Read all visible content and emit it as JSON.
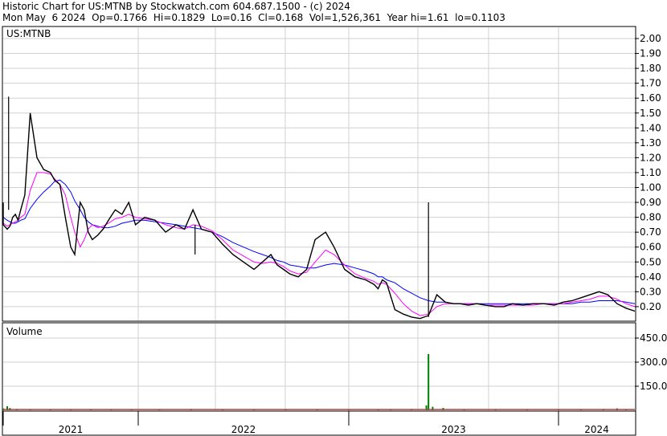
{
  "header": {
    "line1": "Historic Chart for US:MTNB by Stockwatch.com 604.687.1500 - (c) 2024",
    "line2": "Mon May  6 2024  Op=0.1766  Hi=0.1829  Lo=0.16  Cl=0.168  Vol=1,526,361  Year hi=1.61  lo=0.1103"
  },
  "chart_data": [
    {
      "type": "line",
      "title": "US:MTNB",
      "ylim": [
        0.1,
        2.05
      ],
      "y_ticks": [
        "2.00",
        "1.90",
        "1.80",
        "1.70",
        "1.60",
        "1.50",
        "1.40",
        "1.30",
        "1.20",
        "1.10",
        "1.00",
        "0.90",
        "0.80",
        "0.70",
        "0.60",
        "0.50",
        "0.40",
        "0.30",
        "0.20"
      ],
      "x_ticks": [
        "2021",
        "2022",
        "2023",
        "2024"
      ],
      "grid": true,
      "colors": {
        "price": "#000000",
        "ma_short": "#ff00ff",
        "ma_long": "#0000ff"
      },
      "x": [
        2020.73,
        2020.8,
        2020.88,
        2020.95,
        2021.0,
        2021.03,
        2021.05,
        2021.07,
        2021.09,
        2021.11,
        2021.13,
        2021.16,
        2021.2,
        2021.25,
        2021.3,
        2021.35,
        2021.38,
        2021.42,
        2021.46,
        2021.5,
        2021.53,
        2021.57,
        2021.6,
        2021.63,
        2021.66,
        2021.7,
        2021.74,
        2021.78,
        2021.83,
        2021.88,
        2021.93,
        2021.98,
        2022.03,
        2022.08,
        2022.13,
        2022.18,
        2022.22,
        2022.26,
        2022.3,
        2022.35,
        2022.4,
        2022.45,
        2022.5,
        2022.55,
        2022.59,
        2022.63,
        2022.66,
        2022.69,
        2022.72,
        2022.76,
        2022.8,
        2022.84,
        2022.89,
        2022.93,
        2022.98,
        2023.03,
        2023.08,
        2023.12,
        2023.14,
        2023.16,
        2023.18,
        2023.22,
        2023.26,
        2023.3,
        2023.34,
        2023.38,
        2023.42,
        2023.46,
        2023.5,
        2023.53,
        2023.57,
        2023.61,
        2023.65,
        2023.7,
        2023.74,
        2023.78,
        2023.83,
        2023.88,
        2023.93,
        2023.98,
        2024.02,
        2024.06,
        2024.1,
        2024.14,
        2024.18,
        2024.22,
        2024.26,
        2024.3,
        2024.34
      ],
      "price": [
        0.78,
        0.85,
        0.9,
        0.8,
        0.75,
        0.72,
        0.74,
        0.8,
        0.82,
        0.78,
        0.85,
        0.95,
        1.5,
        1.2,
        1.12,
        1.1,
        1.05,
        1.02,
        0.8,
        0.6,
        0.55,
        0.9,
        0.85,
        0.7,
        0.65,
        0.68,
        0.72,
        0.78,
        0.85,
        0.82,
        0.9,
        0.75,
        0.8,
        0.78,
        0.7,
        0.75,
        0.72,
        0.85,
        0.72,
        0.7,
        0.62,
        0.55,
        0.5,
        0.45,
        0.5,
        0.55,
        0.48,
        0.45,
        0.42,
        0.4,
        0.45,
        0.65,
        0.7,
        0.6,
        0.45,
        0.4,
        0.38,
        0.35,
        0.32,
        0.38,
        0.36,
        0.18,
        0.15,
        0.13,
        0.12,
        0.14,
        0.28,
        0.23,
        0.22,
        0.22,
        0.21,
        0.22,
        0.21,
        0.2,
        0.2,
        0.22,
        0.21,
        0.22,
        0.22,
        0.21,
        0.23,
        0.24,
        0.26,
        0.28,
        0.3,
        0.28,
        0.22,
        0.19,
        0.17
      ],
      "ma_short": [
        0.8,
        0.8,
        0.82,
        0.8,
        0.76,
        0.74,
        0.75,
        0.76,
        0.77,
        0.78,
        0.8,
        0.82,
        0.98,
        1.1,
        1.1,
        1.09,
        1.06,
        1.02,
        0.95,
        0.8,
        0.7,
        0.6,
        0.65,
        0.72,
        0.75,
        0.73,
        0.74,
        0.76,
        0.79,
        0.8,
        0.82,
        0.8,
        0.79,
        0.78,
        0.75,
        0.73,
        0.72,
        0.75,
        0.74,
        0.71,
        0.65,
        0.58,
        0.54,
        0.5,
        0.49,
        0.5,
        0.49,
        0.47,
        0.44,
        0.42,
        0.43,
        0.5,
        0.58,
        0.55,
        0.48,
        0.42,
        0.39,
        0.37,
        0.35,
        0.36,
        0.35,
        0.29,
        0.22,
        0.17,
        0.14,
        0.15,
        0.2,
        0.22,
        0.22,
        0.22,
        0.22,
        0.22,
        0.21,
        0.21,
        0.21,
        0.21,
        0.21,
        0.21,
        0.22,
        0.22,
        0.22,
        0.23,
        0.24,
        0.25,
        0.27,
        0.27,
        0.25,
        0.22,
        0.2
      ],
      "ma_long": [
        0.82,
        0.82,
        0.82,
        0.81,
        0.8,
        0.78,
        0.77,
        0.76,
        0.76,
        0.77,
        0.78,
        0.79,
        0.86,
        0.92,
        0.97,
        1.01,
        1.04,
        1.05,
        1.02,
        0.97,
        0.91,
        0.85,
        0.8,
        0.77,
        0.75,
        0.74,
        0.73,
        0.73,
        0.74,
        0.76,
        0.77,
        0.78,
        0.78,
        0.77,
        0.76,
        0.75,
        0.74,
        0.73,
        0.72,
        0.7,
        0.67,
        0.63,
        0.6,
        0.57,
        0.55,
        0.53,
        0.51,
        0.5,
        0.48,
        0.47,
        0.46,
        0.46,
        0.48,
        0.49,
        0.48,
        0.46,
        0.44,
        0.42,
        0.4,
        0.4,
        0.38,
        0.36,
        0.32,
        0.29,
        0.26,
        0.24,
        0.23,
        0.23,
        0.22,
        0.22,
        0.22,
        0.22,
        0.22,
        0.22,
        0.22,
        0.22,
        0.22,
        0.22,
        0.22,
        0.22,
        0.22,
        0.22,
        0.23,
        0.23,
        0.24,
        0.24,
        0.24,
        0.23,
        0.22
      ],
      "spikes": [
        {
          "x": 2023.38,
          "low": 0.13,
          "high": 0.9
        },
        {
          "x": 2021.04,
          "low": 0.85,
          "high": 1.61
        },
        {
          "x": 2022.27,
          "low": 0.55,
          "high": 0.75
        }
      ]
    },
    {
      "type": "bar",
      "title": "Volume",
      "ylim": [
        0,
        530
      ],
      "y_ticks": [
        "450.0",
        "300.0",
        "150.0"
      ],
      "grid": true,
      "colors": {
        "volume": "#008000"
      },
      "x": [
        2020.73,
        2020.85,
        2021.0,
        2021.03,
        2021.05,
        2021.1,
        2021.2,
        2021.35,
        2021.5,
        2021.65,
        2021.8,
        2021.95,
        2022.1,
        2022.25,
        2022.4,
        2022.55,
        2022.7,
        2022.85,
        2023.0,
        2023.14,
        2023.2,
        2023.3,
        2023.37,
        2023.38,
        2023.4,
        2023.45,
        2023.55,
        2023.7,
        2023.85,
        2024.0,
        2024.1,
        2024.2,
        2024.26,
        2024.3
      ],
      "volume": [
        5,
        6,
        12,
        25,
        14,
        8,
        6,
        5,
        6,
        5,
        5,
        4,
        6,
        8,
        5,
        6,
        5,
        4,
        5,
        7,
        6,
        8,
        30,
        350,
        22,
        15,
        6,
        5,
        4,
        5,
        6,
        8,
        12,
        7
      ]
    }
  ]
}
